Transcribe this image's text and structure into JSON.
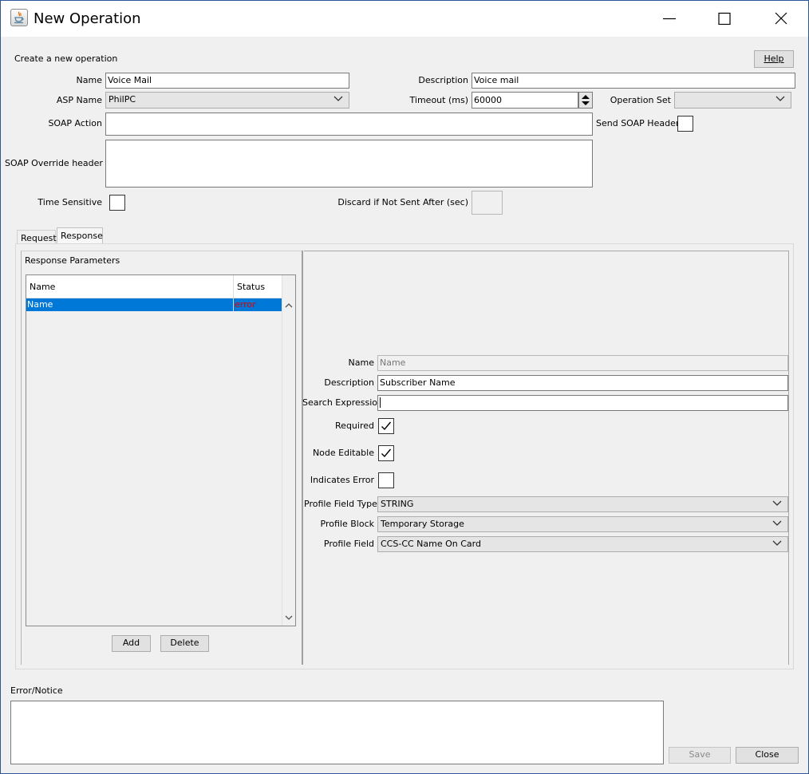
{
  "window": {
    "title": "New Operation"
  },
  "form": {
    "heading": "Create a new operation",
    "help_label": "Help",
    "name": {
      "label": "Name",
      "value": "Voice Mail"
    },
    "description": {
      "label": "Description",
      "value": "Voice mail"
    },
    "asp_name": {
      "label": "ASP Name",
      "value": "PhilPC"
    },
    "timeout": {
      "label": "Timeout (ms)",
      "value": "60000"
    },
    "operation_set": {
      "label": "Operation Set",
      "value": ""
    },
    "soap_action": {
      "label": "SOAP Action",
      "value": ""
    },
    "send_soap_header": {
      "label": "Send SOAP Header",
      "checked": false
    },
    "soap_override_header": {
      "label": "SOAP Override header",
      "value": ""
    },
    "time_sensitive": {
      "label": "Time Sensitive",
      "checked": false
    },
    "discard_if_not_sent": {
      "label": "Discard if Not Sent After (sec)",
      "value": ""
    }
  },
  "tabs": [
    {
      "label": "Request",
      "selected": false
    },
    {
      "label": "Response",
      "selected": true
    }
  ],
  "response_params": {
    "title": "Response Parameters",
    "columns": [
      "Name",
      "Status"
    ],
    "rows": [
      {
        "name": "Name",
        "status": "error",
        "selected": true
      }
    ],
    "add_label": "Add",
    "delete_label": "Delete"
  },
  "detail": {
    "name": {
      "label": "Name",
      "value": "Name"
    },
    "description": {
      "label": "Description",
      "value": "Subscriber Name"
    },
    "search_expression": {
      "label": "Search Expression",
      "value": ""
    },
    "required": {
      "label": "Required",
      "checked": true
    },
    "node_editable": {
      "label": "Node Editable",
      "checked": true
    },
    "indicates_error": {
      "label": "Indicates Error",
      "checked": false
    },
    "profile_field_type": {
      "label": "Profile Field Type",
      "value": "STRING"
    },
    "profile_block": {
      "label": "Profile Block",
      "value": "Temporary Storage"
    },
    "profile_field": {
      "label": "Profile Field",
      "value": "CCS-CC Name On Card"
    }
  },
  "footer": {
    "error_notice_label": "Error/Notice",
    "error_notice_value": "",
    "save_label": "Save",
    "close_label": "Close"
  },
  "colors": {
    "selection": "#0078d7",
    "error_text": "#e00000",
    "window_border": "#2b579a"
  }
}
